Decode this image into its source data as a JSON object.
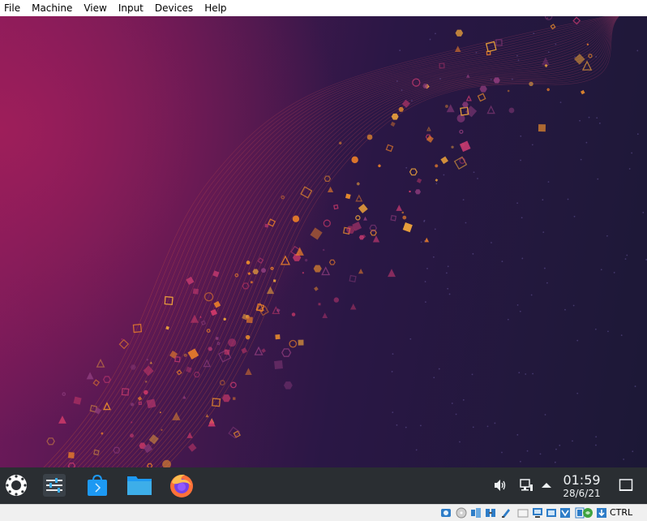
{
  "menubar": {
    "items": [
      "File",
      "Machine",
      "View",
      "Input",
      "Devices",
      "Help"
    ]
  },
  "taskbar": {
    "launchers": [
      {
        "name": "application-launcher",
        "icon": "kde-menu-icon"
      },
      {
        "name": "system-settings",
        "icon": "settings-sliders-icon"
      },
      {
        "name": "discover",
        "icon": "store-bag-icon"
      },
      {
        "name": "dolphin",
        "icon": "folder-icon"
      },
      {
        "name": "firefox",
        "icon": "firefox-icon"
      }
    ],
    "tray": [
      "volume-icon",
      "network-icon",
      "expand-arrow-icon"
    ],
    "clock": {
      "time": "01:59",
      "date": "28/6/21"
    }
  },
  "statusbar": {
    "icons": [
      "hard-disk-icon",
      "optical-disk-icon",
      "audio-icon",
      "network-adapter-icon",
      "usb-icon",
      "shared-folder-icon",
      "display-icon",
      "recording-icon",
      "vt-x-icon",
      "mouse-integration-icon",
      "arrow-down-icon"
    ],
    "host_key": "CTRL"
  },
  "colors": {
    "menubar_bg": "#ffffff",
    "taskbar_bg": "#2a2e32",
    "wallpaper_dark": "#1c1836",
    "wallpaper_magenta": "#a01e5a",
    "accent_orange": "#e87d2a"
  }
}
